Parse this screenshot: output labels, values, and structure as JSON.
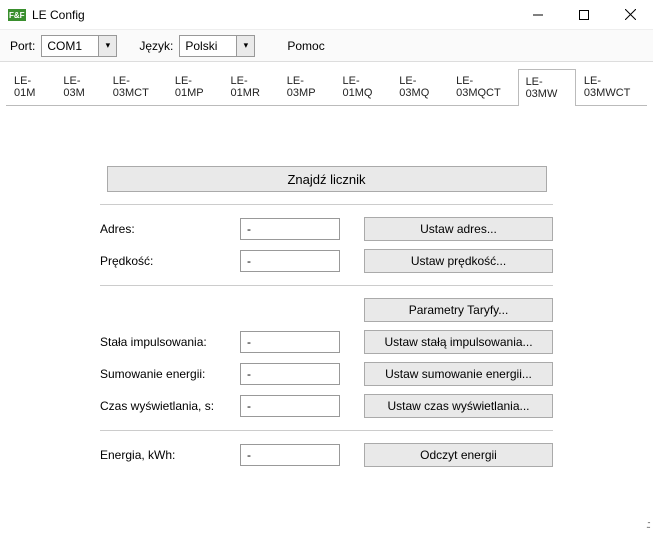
{
  "window": {
    "title": "LE Config",
    "logo_text": "F&F",
    "logo_color": "#3a8f2e"
  },
  "toolbar": {
    "port_label": "Port:",
    "port_value": "COM1",
    "lang_label": "Język:",
    "lang_value": "Polski",
    "help_label": "Pomoc"
  },
  "tabs": [
    "LE-01M",
    "LE-03M",
    "LE-03MCT",
    "LE-01MP",
    "LE-01MR",
    "LE-03MP",
    "LE-01MQ",
    "LE-03MQ",
    "LE-03MQCT",
    "LE-03MW",
    "LE-03MWCT"
  ],
  "active_tab_index": 9,
  "buttons": {
    "find_meter": "Znajdź licznik",
    "set_address": "Ustaw adres...",
    "set_speed": "Ustaw prędkość...",
    "tariff_params": "Parametry Taryfy...",
    "set_pulse_const": "Ustaw stałą impulsowania...",
    "set_energy_sum": "Ustaw sumowanie energii...",
    "set_display_time": "Ustaw czas wyświetlania...",
    "read_energy": "Odczyt energii"
  },
  "fields": {
    "address": {
      "label": "Adres:",
      "value": "-"
    },
    "speed": {
      "label": "Prędkość:",
      "value": "-"
    },
    "pulse_const": {
      "label": "Stała impulsowania:",
      "value": "-"
    },
    "energy_sum": {
      "label": "Sumowanie energii:",
      "value": "-"
    },
    "display_time": {
      "label": "Czas wyświetlania, s:",
      "value": "-"
    },
    "energy": {
      "label": "Energia, kWh:",
      "value": "-"
    }
  }
}
